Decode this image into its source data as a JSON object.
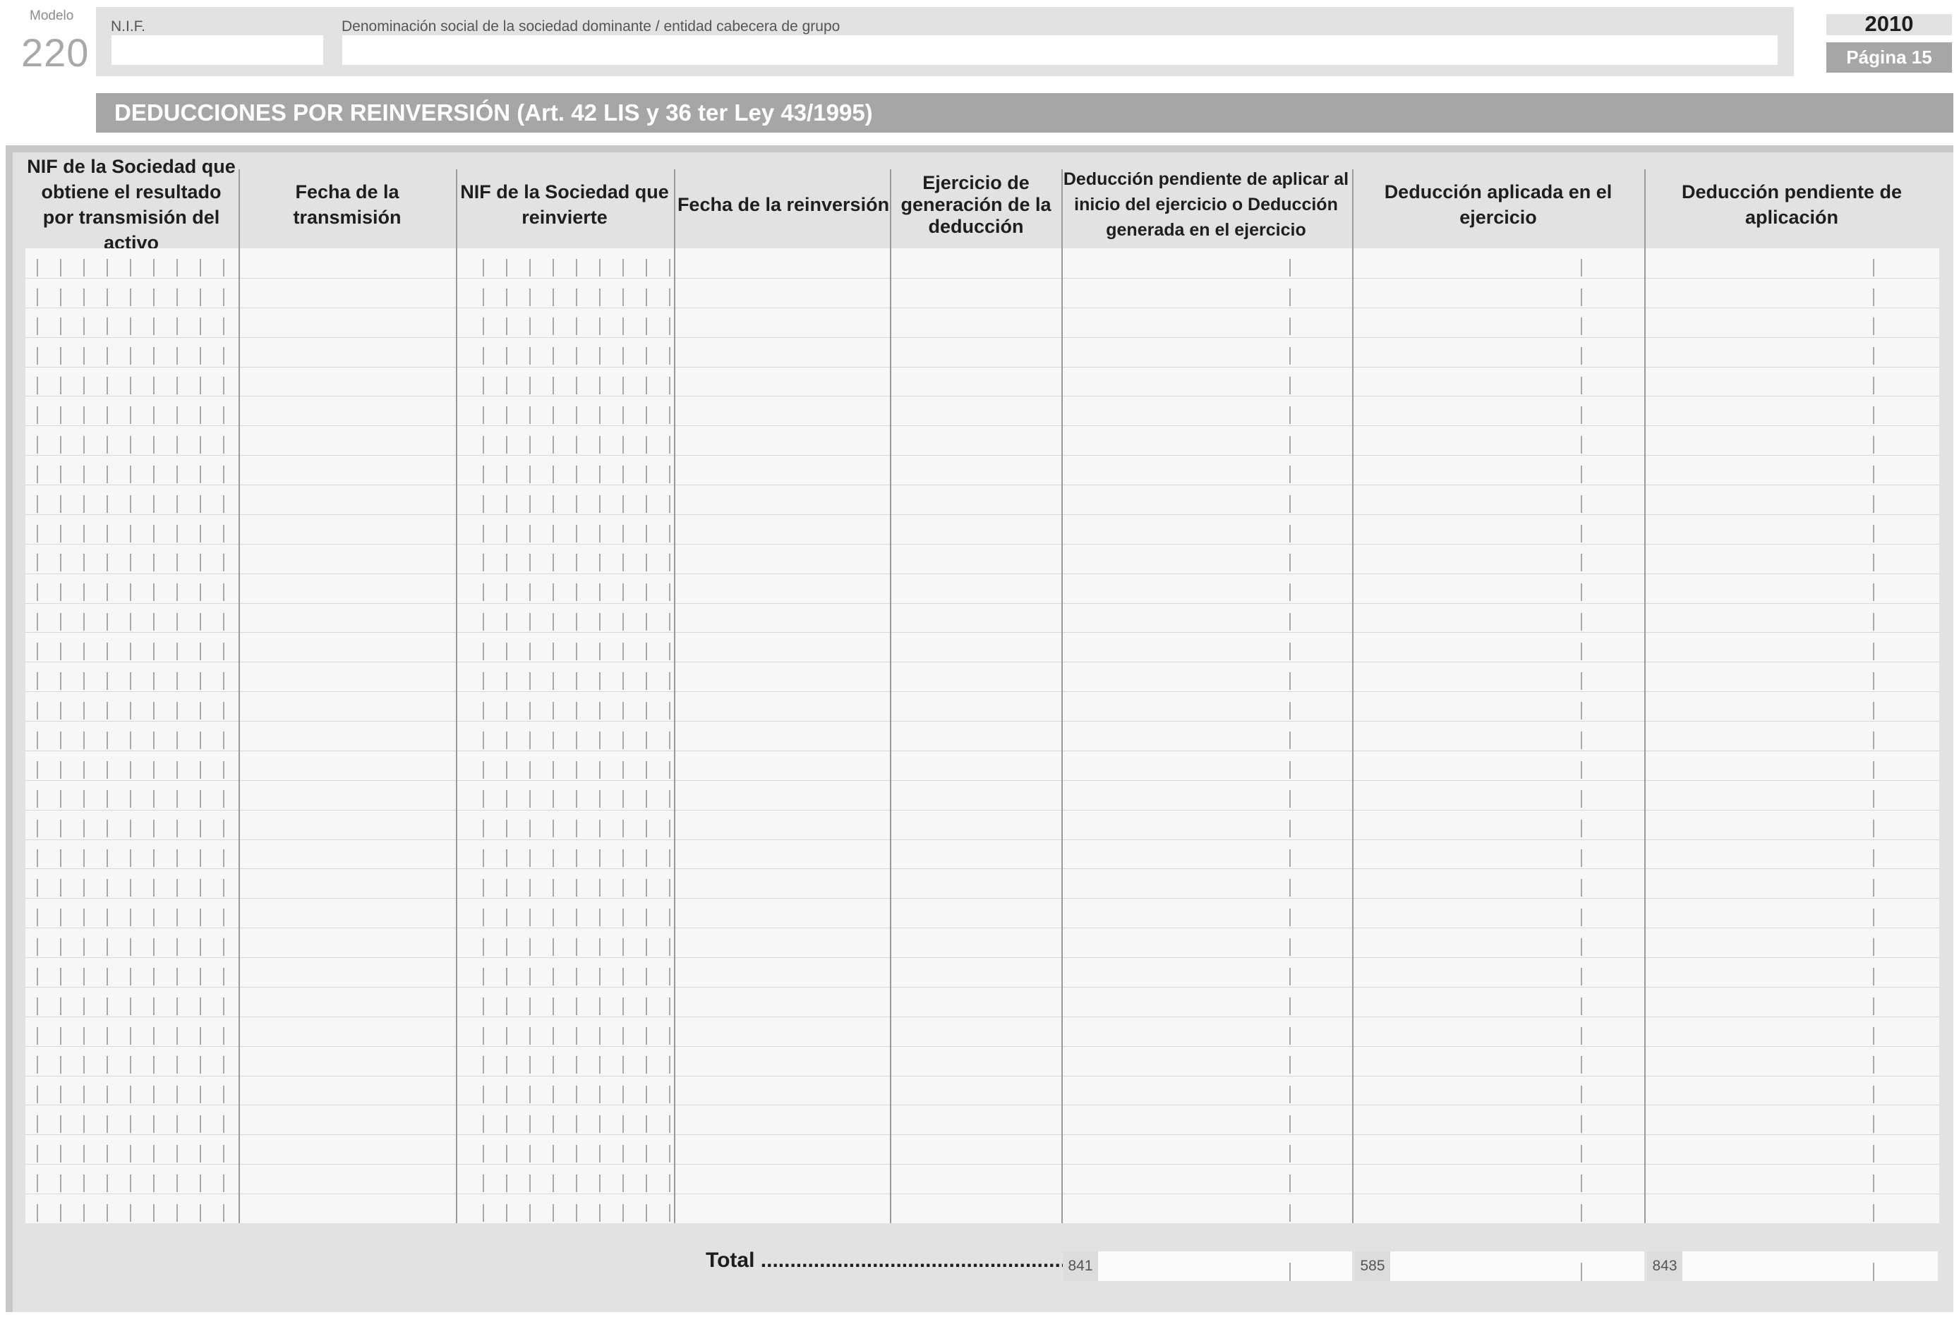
{
  "header": {
    "modelo_label": "Modelo",
    "modelo_number": "220",
    "nif_label": "N.I.F.",
    "denominacion_label": "Denominación social de la sociedad dominante / entidad cabecera de grupo",
    "year": "2010",
    "page": "Página 15"
  },
  "section": {
    "title": "DEDUCCIONES POR REINVERSIÓN (Art. 42 LIS y 36 ter Ley 43/1995)"
  },
  "table": {
    "columns": [
      "NIF de la Sociedad que obtiene el resultado por transmisión del activo",
      "Fecha de la transmisión",
      "NIF de la Sociedad que reinvierte",
      "Fecha de la reinversión",
      "Ejercicio de generación de la deducción",
      "Deducción pendiente de aplicar al inicio del ejercicio o Deducción generada en el ejercicio",
      "Deducción aplicada en el ejercicio",
      "Deducción pendiente de aplicación"
    ],
    "row_count": 33
  },
  "totals": {
    "label": "Total ......................................................",
    "boxes": [
      {
        "code": "841",
        "value": ""
      },
      {
        "code": "585",
        "value": ""
      },
      {
        "code": "843",
        "value": ""
      }
    ]
  }
}
